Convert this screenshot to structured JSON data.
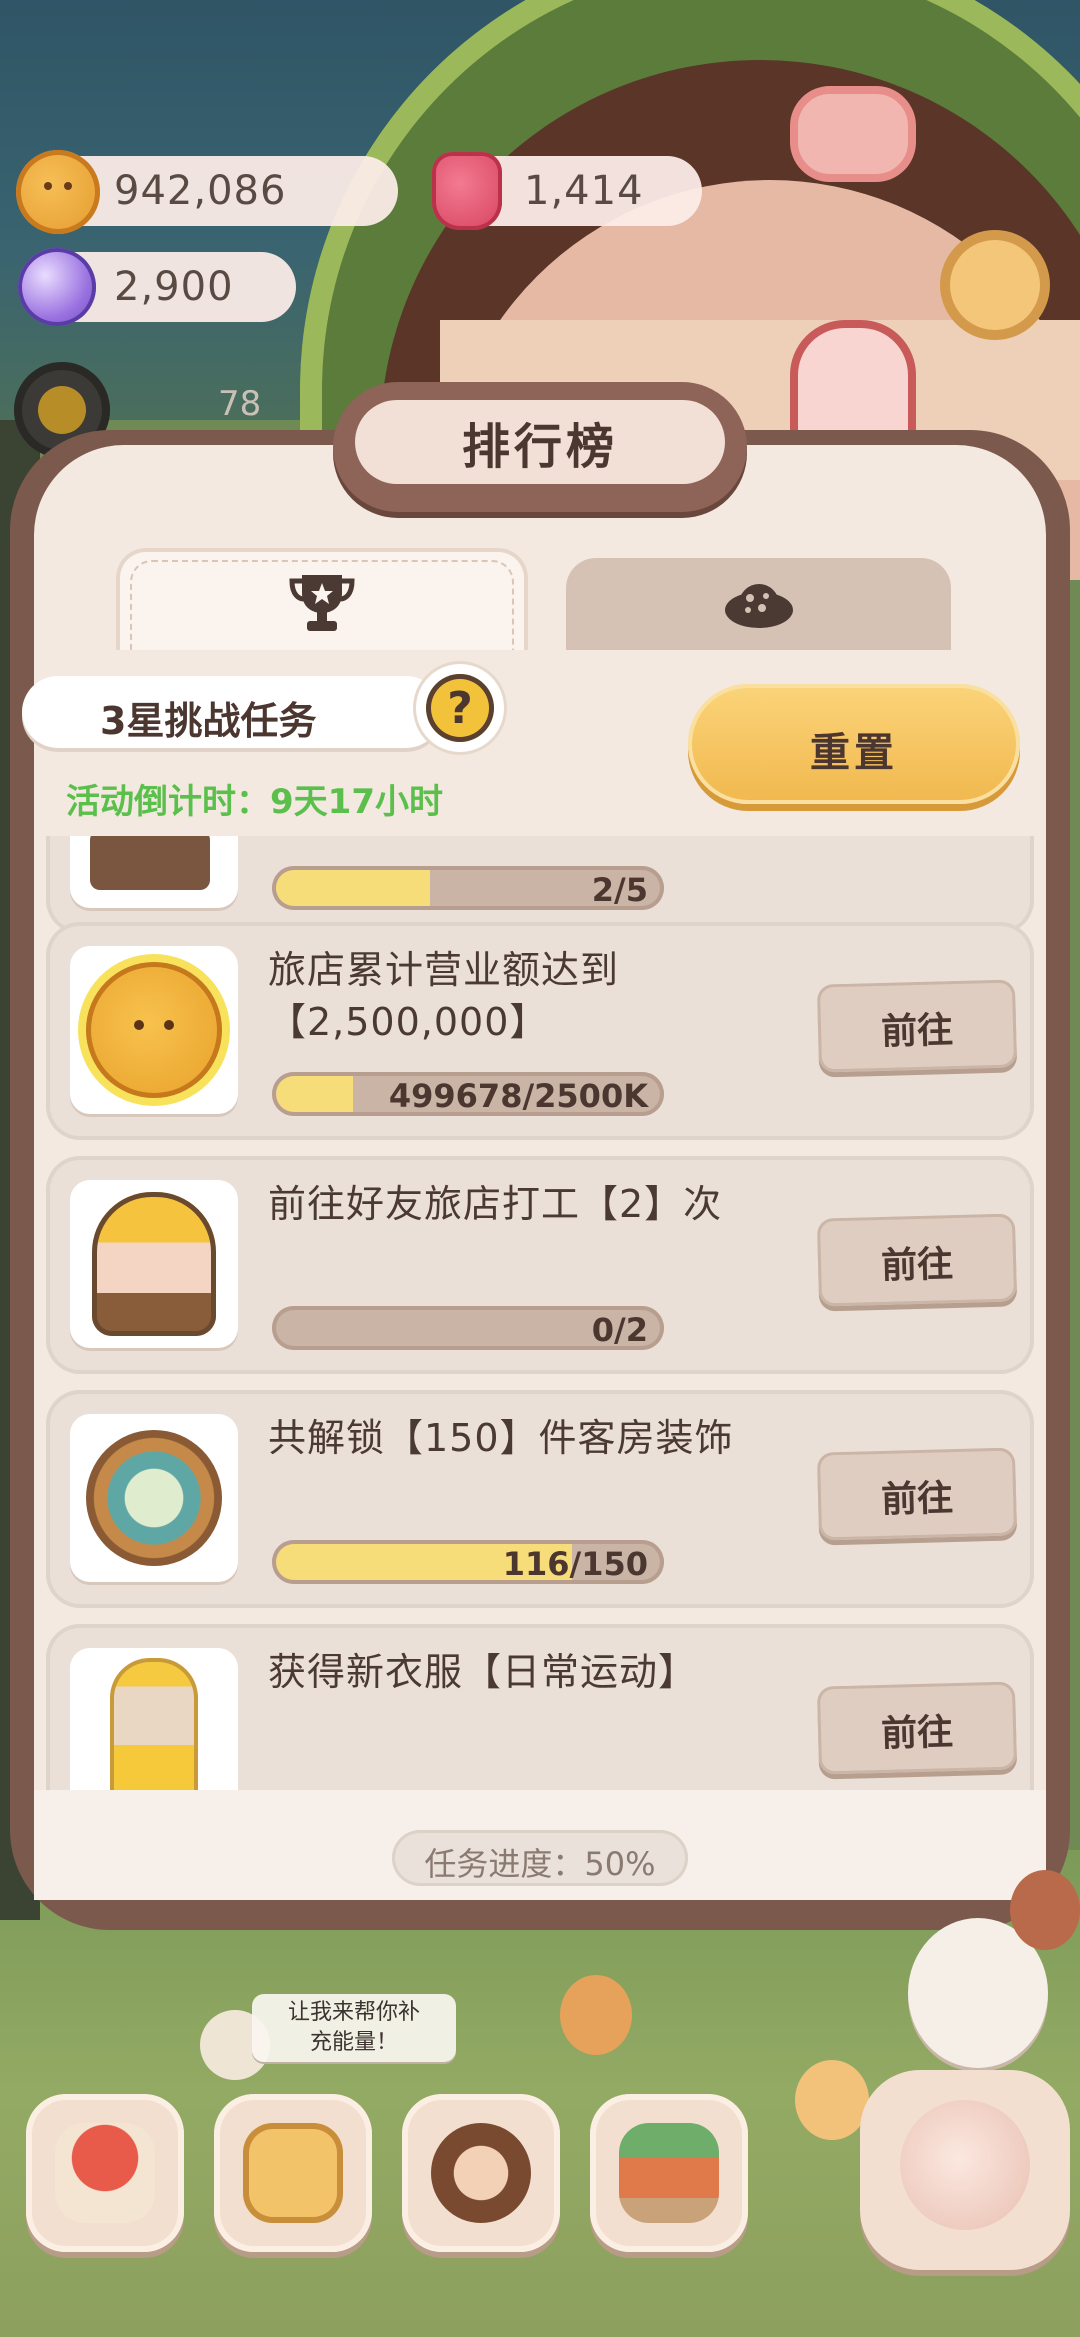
{
  "currencies": {
    "coins": "942,086",
    "gems": "1,414",
    "crystals": "2,900",
    "level": "78"
  },
  "modal": {
    "title": "排行榜",
    "tabs": [
      {
        "icon": "trophy-icon",
        "active": true
      },
      {
        "icon": "cookie-planet-icon",
        "active": false
      }
    ],
    "challenge_label": "3星挑战任务",
    "help_label": "?",
    "countdown": "活动倒计时：9天17小时",
    "reset_label": "重置",
    "progress_footer": "任务进度：50%"
  },
  "tasks": [
    {
      "title": "",
      "progress_text": "2/5",
      "progress": 0.4,
      "button": "",
      "thumb": "partial-item"
    },
    {
      "title": "旅店累计营业额达到【2,500,000】",
      "progress_text": "499678/2500K",
      "progress": 0.2,
      "button": "前往",
      "thumb": "cookie-coin"
    },
    {
      "title": "前往好友旅店打工【2】次",
      "progress_text": "0/2",
      "progress": 0.0,
      "button": "前往",
      "thumb": "worker-character"
    },
    {
      "title": "共解锁【150】件客房装饰",
      "progress_text": "116/150",
      "progress": 0.77,
      "button": "前往",
      "thumb": "decoration-medal"
    },
    {
      "title": "获得新衣服【日常运动】",
      "progress_text": "",
      "progress": 0,
      "button": "前往",
      "thumb": "outfit-doll"
    }
  ],
  "speech_bubble": "让我来帮你补\n充能量！",
  "colors": {
    "accent_yellow": "#f1b84e",
    "countdown_green": "#5bbf4c",
    "modal_bg": "#f4e9e1",
    "frame_brown": "#7b5a4d"
  }
}
